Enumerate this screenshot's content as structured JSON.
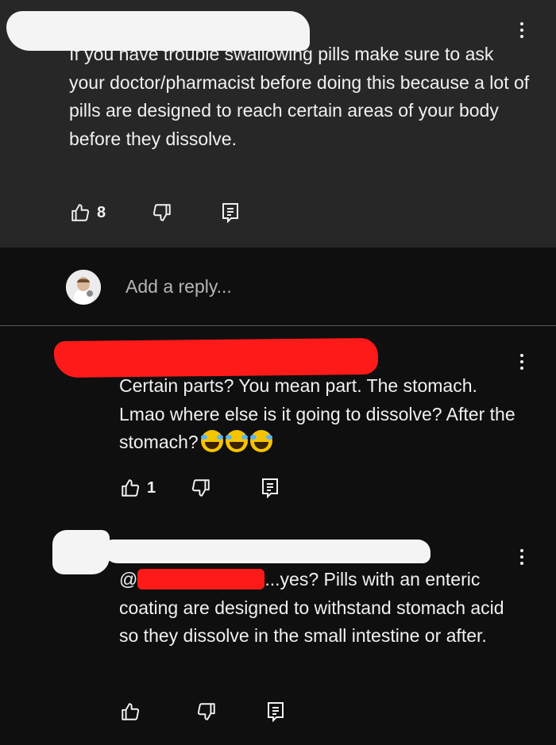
{
  "comment1": {
    "text": "If you have trouble swallowing pills make sure to ask your doctor/pharmacist before doing this because a lot of pills are designed to reach certain areas of your body before they dissolve.",
    "likes": "8"
  },
  "reply_box": {
    "placeholder": "Add a reply..."
  },
  "reply1": {
    "text": "Certain parts? You mean part. The stomach. Lmao where else is it going to dissolve? After the stomach?",
    "emojis": [
      "😂",
      "😂",
      "😂"
    ],
    "likes": "1"
  },
  "reply2": {
    "mention_prefix": "@",
    "text": "...yes? Pills with an enteric coating are designed to withstand stomach acid so they dissolve in the small intestine or after.",
    "likes": ""
  },
  "icons": {
    "like": "thumbs-up-icon",
    "dislike": "thumbs-down-icon",
    "reply": "reply-icon",
    "more": "kebab-menu-icon"
  }
}
